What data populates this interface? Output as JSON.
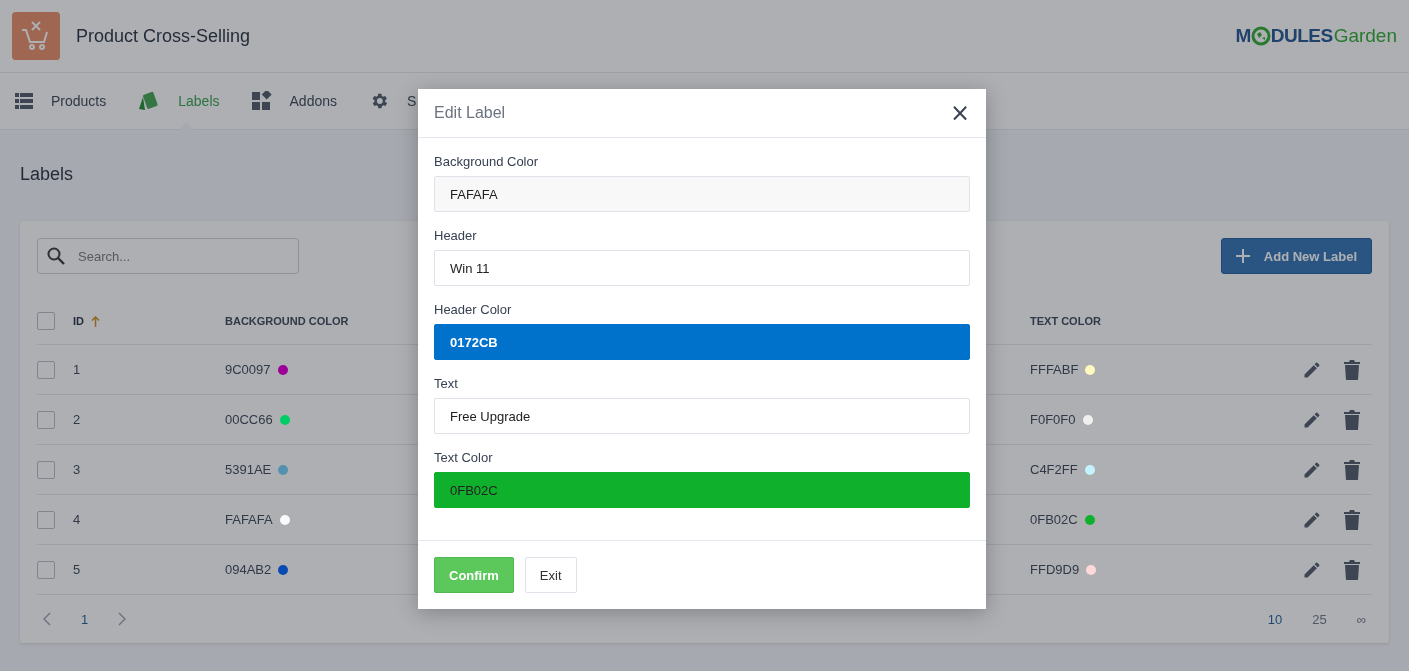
{
  "app": {
    "title": "Product Cross-Selling",
    "logo": {
      "left": "M",
      "right": "DULES",
      "suffix": "Garden"
    }
  },
  "tabs": [
    {
      "label": "Products",
      "selected": false
    },
    {
      "label": "Labels",
      "selected": true
    },
    {
      "label": "Addons",
      "selected": false
    },
    {
      "label": "S",
      "selected": false
    }
  ],
  "page_title": "Labels",
  "search": {
    "placeholder": "Search..."
  },
  "add_button": "Add New Label",
  "table": {
    "select_all": {
      "checked": false
    },
    "columns": [
      {
        "label": "ID",
        "sorted": true
      },
      {
        "label": "BACKGROUND COLOR",
        "sorted": false
      },
      {
        "label": "TEXT COLOR",
        "sorted": false
      }
    ],
    "rows": [
      {
        "id": "1",
        "checked": false,
        "background": {
          "text": "9C0097",
          "color": "#9c0097"
        },
        "text_color": {
          "text": "FFFABF",
          "color": "#fffabf"
        }
      },
      {
        "id": "2",
        "checked": false,
        "background": {
          "text": "00CC66",
          "color": "#00cc66"
        },
        "text_color": {
          "text": "F0F0F0",
          "color": "#f0f0f0"
        }
      },
      {
        "id": "3",
        "checked": false,
        "background": {
          "text": "5391AE",
          "color": "#5391ae"
        },
        "text_color": {
          "text": "C4F2FF",
          "color": "#c4f2ff"
        }
      },
      {
        "id": "4",
        "checked": false,
        "background": {
          "text": "FAFAFA",
          "color": "#fafafa"
        },
        "text_color": {
          "text": "0FB02C",
          "color": "#0fb02c"
        }
      },
      {
        "id": "5",
        "checked": false,
        "background": {
          "text": "094AB2",
          "color": "#094ab2"
        },
        "text_color": {
          "text": "FFD9D9",
          "color": "#ffd9d9"
        }
      }
    ]
  },
  "pagination": {
    "pages": [
      {
        "label": "1",
        "selected": true
      }
    ],
    "sizes": [
      {
        "label": "10",
        "selected": true
      },
      {
        "label": "25",
        "selected": false
      },
      {
        "label": "∞",
        "selected": false
      }
    ]
  },
  "modal": {
    "title": "Edit Label",
    "close": "×",
    "fields": [
      {
        "kind": "color",
        "label": "Background Color",
        "value": "FAFAFA",
        "color": "#f8f8f8"
      },
      {
        "kind": "text",
        "label": "Header",
        "value": "Win 11"
      },
      {
        "kind": "color",
        "label": "Header Color",
        "value": "0172CB",
        "color": "#0172cb"
      },
      {
        "kind": "text",
        "label": "Text",
        "value": "Free Upgrade"
      },
      {
        "kind": "color",
        "label": "Text Color",
        "value": "0FB02C",
        "color": "#0fb02c"
      }
    ],
    "buttons": [
      {
        "label": "Confirm",
        "kind": "primary"
      },
      {
        "label": "Exit",
        "kind": "secondary"
      }
    ]
  }
}
